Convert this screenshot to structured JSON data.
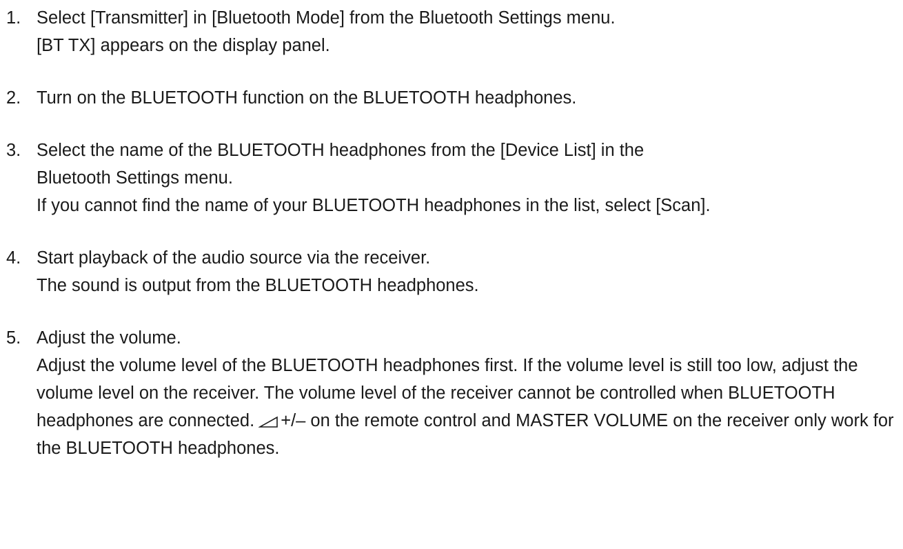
{
  "steps": [
    {
      "number": "1.",
      "lines": [
        "Select [Transmitter] in [Bluetooth Mode] from the Bluetooth Settings menu.",
        "[BT TX] appears on the display panel."
      ]
    },
    {
      "number": "2.",
      "lines": [
        "Turn on the BLUETOOTH function on the BLUETOOTH headphones."
      ]
    },
    {
      "number": "3.",
      "lines": [
        "Select the name of the BLUETOOTH headphones from the [Device List] in the",
        "Bluetooth Settings menu.",
        "If you cannot find the name of your BLUETOOTH headphones in the list, select [Scan]."
      ]
    },
    {
      "number": "4.",
      "lines": [
        "Start playback of the audio source via the receiver.",
        "The sound is output from the BLUETOOTH headphones."
      ]
    },
    {
      "number": "5.",
      "heading": "Adjust the volume.",
      "para_before_icon": "Adjust the volume level of the BLUETOOTH headphones first. If the volume level is still too low, adjust the volume level on the receiver. The volume level of the receiver cannot be controlled when BLUETOOTH headphones are connected.",
      "para_after_icon": "+/– on the remote control and MASTER VOLUME on the receiver only work for the BLUETOOTH headphones.",
      "icon": "volume-wedge-icon"
    }
  ]
}
